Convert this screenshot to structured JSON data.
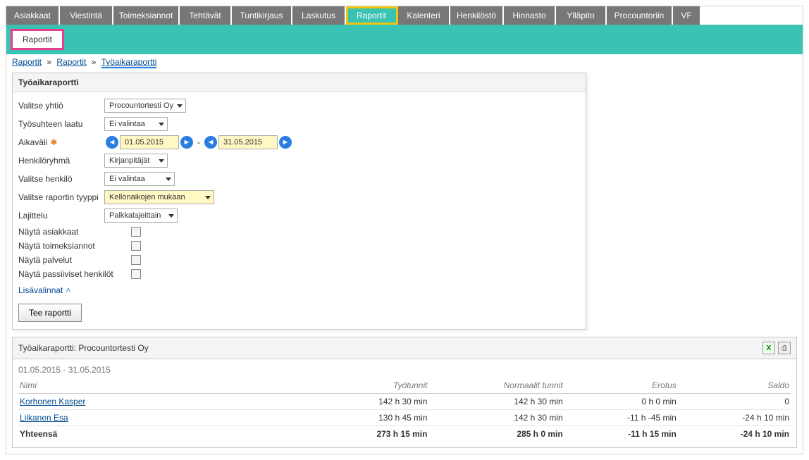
{
  "nav": {
    "tabs": [
      "Asiakkaat",
      "Viestintä",
      "Toimeksiannot",
      "Tehtävät",
      "Tuntikirjaus",
      "Laskutus",
      "Raportit",
      "Kalenteri",
      "Henkilöstö",
      "Hinnasto",
      "Ylläpito",
      "Procountoriin",
      "VF"
    ],
    "active_index": 6,
    "widths": [
      76,
      76,
      94,
      74,
      86,
      76,
      74,
      74,
      76,
      74,
      72,
      94,
      40
    ]
  },
  "subnav": {
    "label": "Raportit"
  },
  "breadcrumb": {
    "parts": [
      "Raportit",
      "Raportit",
      "Työaikaraportti"
    ]
  },
  "panel": {
    "title": "Työaikaraportti",
    "fields": {
      "company_label": "Valitse yhtiö",
      "company_value": "Procountortesti Oy",
      "emptype_label": "Työsuhteen laatu",
      "emptype_value": "Ei valintaa",
      "range_label": "Aikaväli",
      "date_from": "01.05.2015",
      "date_to": "31.05.2015",
      "group_label": "Henkilöryhmä",
      "group_value": "Kirjanpitäjät",
      "person_label": "Valitse henkilö",
      "person_value": "Ei valintaa",
      "rtype_label": "Valitse raportin tyyppi",
      "rtype_value": "Kellonaikojen mukaan",
      "sort_label": "Lajittelu",
      "sort_value": "Palkkalajeittain",
      "show_customers": "Näytä asiakkaat",
      "show_assignments": "Näytä toimeksiannot",
      "show_services": "Näytä palvelut",
      "show_passive": "Näytä passiiviset henkilöt",
      "lisavalinnat": "Lisävalinnat",
      "button": "Tee raportti"
    }
  },
  "report": {
    "title": "Työaikaraportti: Procountortesti Oy",
    "date_range": "01.05.2015 - 31.05.2015",
    "columns": [
      "Nimi",
      "Työtunnit",
      "Normaalit tunnit",
      "Erotus",
      "Saldo"
    ],
    "rows": [
      {
        "name": "Korhonen Kasper",
        "work": "142 h 30 min",
        "normal": "142 h 30 min",
        "diff": "0 h 0 min",
        "saldo": "0"
      },
      {
        "name": "Liikanen Esa",
        "work": "130 h 45 min",
        "normal": "142 h 30 min",
        "diff": "-11 h -45 min",
        "saldo": "-24 h 10 min"
      }
    ],
    "total": {
      "label": "Yhteensä",
      "work": "273 h 15 min",
      "normal": "285 h 0 min",
      "diff": "-11 h 15 min",
      "saldo": "-24 h 10 min"
    },
    "excel_label": "X"
  }
}
